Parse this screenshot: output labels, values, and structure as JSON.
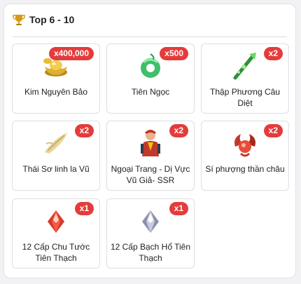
{
  "header": {
    "title": "Top 6 - 10"
  },
  "items": [
    {
      "label": "Kim Nguyên Bảo",
      "badge": "x400,000"
    },
    {
      "label": "Tiên Ngọc",
      "badge": "x500"
    },
    {
      "label": "Thập Phương Câu Diệt",
      "badge": "x2"
    },
    {
      "label": "Thái Sơ linh la Vũ",
      "badge": "x2"
    },
    {
      "label": "Ngoại Trang - Dị Vực Vũ Giả- SSR",
      "badge": "x2"
    },
    {
      "label": "Sí phượng thần châu",
      "badge": "x2"
    },
    {
      "label": "12 Cấp Chu Tước Tiên Thạch",
      "badge": "x1"
    },
    {
      "label": "12 Cấp Bạch Hổ Tiên Thạch",
      "badge": "x1"
    }
  ],
  "colors": {
    "badge": "#e53b3b",
    "accent": "#d49a1a"
  }
}
